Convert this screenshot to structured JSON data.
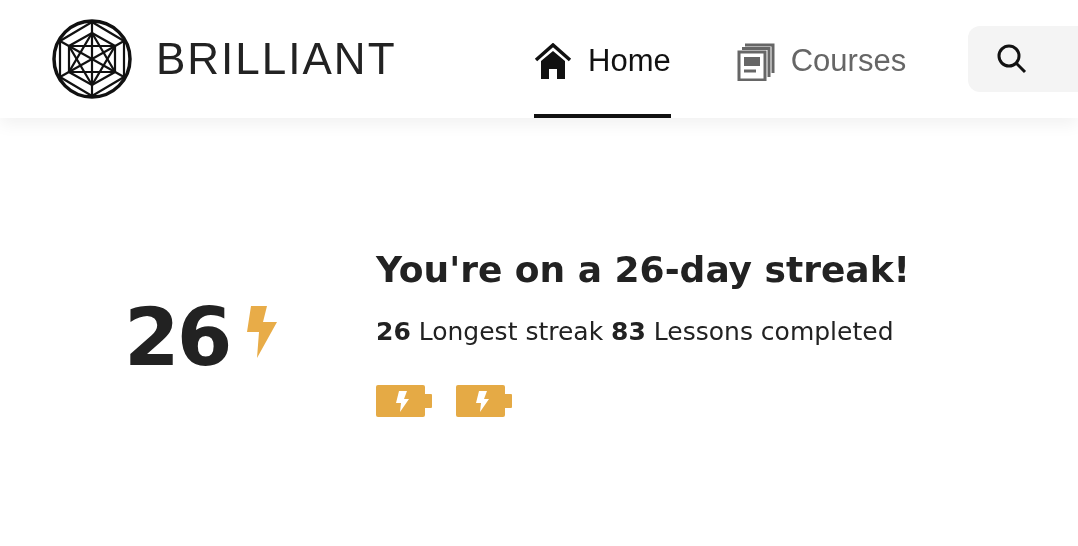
{
  "brand": {
    "name": "BRILLIANT"
  },
  "tabs": [
    {
      "label": "Home",
      "kind": "home",
      "selected": true
    },
    {
      "label": "Courses",
      "kind": "courses",
      "selected": false
    }
  ],
  "streak": {
    "count": "26",
    "headline": "You're on a 26-day streak!",
    "stats": "**26** Longest streak **83** Lessons completed"
  }
}
